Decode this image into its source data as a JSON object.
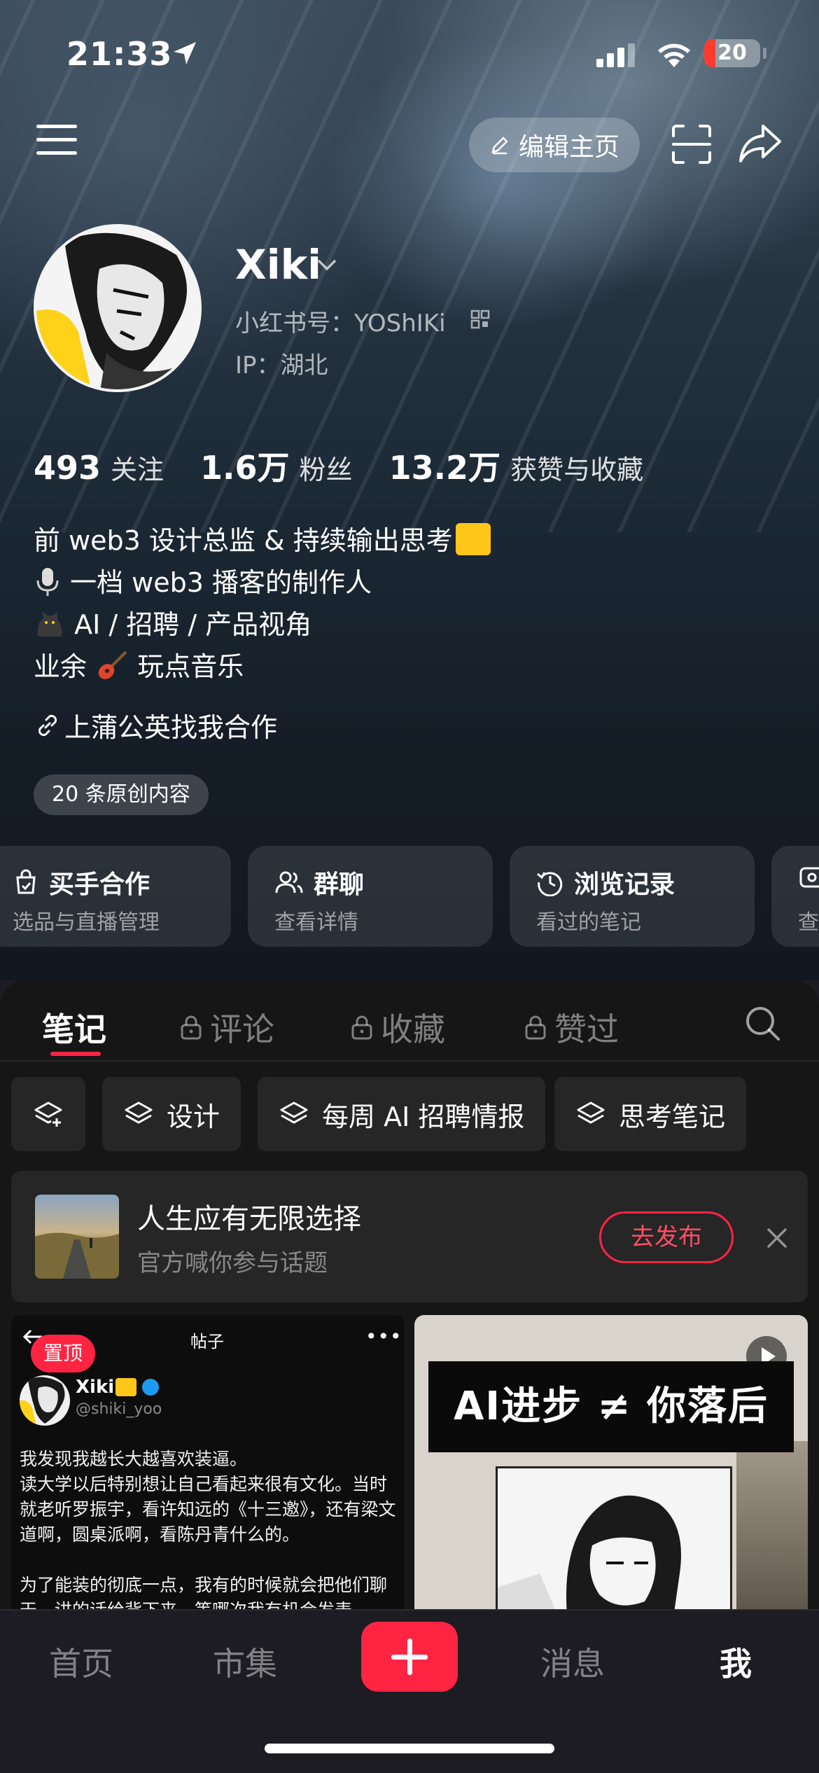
{
  "status_bar": {
    "time": "21:33",
    "battery": "20",
    "battery_level": 0.2
  },
  "top_bar": {
    "edit_label": "编辑主页"
  },
  "profile": {
    "name": "Xiki",
    "red_id": "小红书号：YOShIKi",
    "ip": "IP：湖北"
  },
  "stats": [
    {
      "value": "493",
      "label": "关注"
    },
    {
      "value": "1.6万",
      "label": "粉丝"
    },
    {
      "value": "13.2万",
      "label": "获赞与收藏"
    }
  ],
  "bio": {
    "line1": "前 web3 设计总监 &  持续输出思考",
    "line2": "一档 web3 播客的制作人",
    "line3": "AI / 招聘 / 产品视角",
    "line4_a": "业余",
    "line4_b": "玩点音乐"
  },
  "link_text": "上蒲公英找我合作",
  "original_badge": "20 条原创内容",
  "quick_cards": [
    {
      "title": "买手合作",
      "subtitle": "选品与直播管理"
    },
    {
      "title": "群聊",
      "subtitle": "查看详情"
    },
    {
      "title": "浏览记录",
      "subtitle": "看过的笔记"
    },
    {
      "title": "",
      "subtitle": "查"
    }
  ],
  "tabs": [
    "笔记",
    "评论",
    "收藏",
    "赞过"
  ],
  "chips": [
    "设计",
    "每周 AI 招聘情报",
    "思考笔记"
  ],
  "topic": {
    "title": "人生应有无限选择",
    "subtitle": "官方喊你参与话题",
    "button": "去发布"
  },
  "card1": {
    "header_title": "帖子",
    "pin": "置顶",
    "author": "Xiki",
    "handle": "@shiki_yoo",
    "para1": "我发现我越长大越喜欢装逼。",
    "para2": "读大学以后特别想让自己看起来很有文化。当时就老听罗振宇，看许知远的《十三邀》，还有梁文道啊，圆桌派啊，看陈丹青什么的。",
    "para3": "为了能装的彻底一点，我有的时候就会把他们聊天、讲的话给背下来，等哪次我有机会发表"
  },
  "card2": {
    "banner": "AI进步 ≠ 你落后"
  },
  "bottom_nav": [
    "首页",
    "市集",
    "消息",
    "我"
  ],
  "colors": {
    "accent": "#ff2442",
    "background": "#161616",
    "badge_yellow": "#ffc61a"
  }
}
